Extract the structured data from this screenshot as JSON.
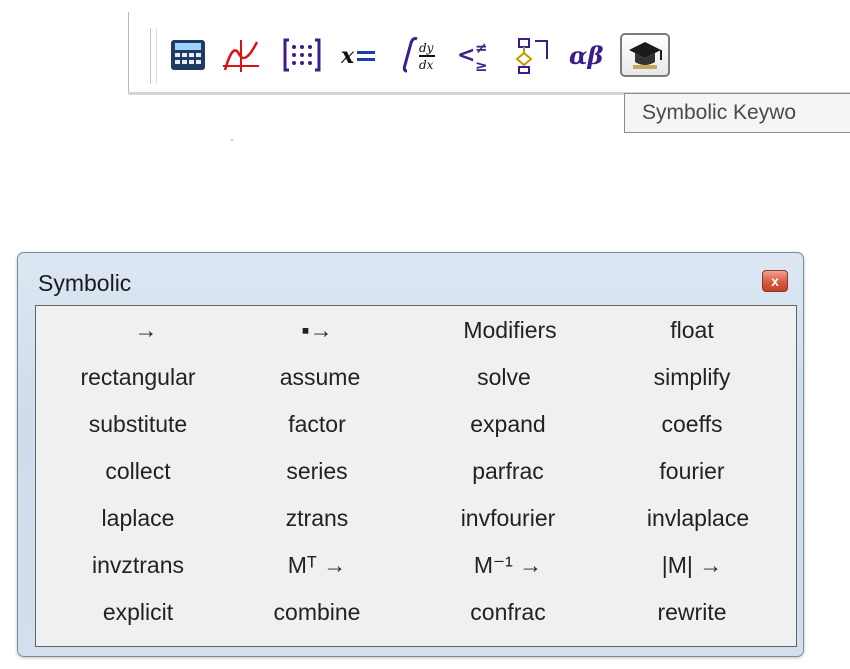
{
  "toolbar": {
    "buttons": [
      {
        "name": "calculator-icon"
      },
      {
        "name": "graph-icon"
      },
      {
        "name": "matrix-icon"
      },
      {
        "name": "evaluation-icon"
      },
      {
        "name": "calculus-icon"
      },
      {
        "name": "boolean-icon"
      },
      {
        "name": "programming-icon"
      },
      {
        "name": "greek-icon"
      },
      {
        "name": "symbolic-keywords-icon",
        "active": true
      }
    ],
    "tooltip": "Symbolic Keywo"
  },
  "palette": {
    "title": "Symbolic",
    "close_label": "x",
    "rows": [
      [
        "→",
        "▪→",
        "Modifiers",
        "float"
      ],
      [
        "rectangular",
        "assume",
        "solve",
        "simplify"
      ],
      [
        "substitute",
        "factor",
        "expand",
        "coeffs"
      ],
      [
        "collect",
        "series",
        "parfrac",
        "fourier"
      ],
      [
        "laplace",
        "ztrans",
        "invfourier",
        "invlaplace"
      ],
      [
        "invztrans",
        "Mᵀ →",
        "M⁻¹ →",
        "|M| →"
      ],
      [
        "explicit",
        "combine",
        "confrac",
        "rewrite"
      ]
    ]
  },
  "colors": {
    "window_frame": "#d3dfec",
    "close_red": "#d9583f",
    "greek_purple": "#3b1e8a",
    "graph_red": "#cc1a1a"
  }
}
